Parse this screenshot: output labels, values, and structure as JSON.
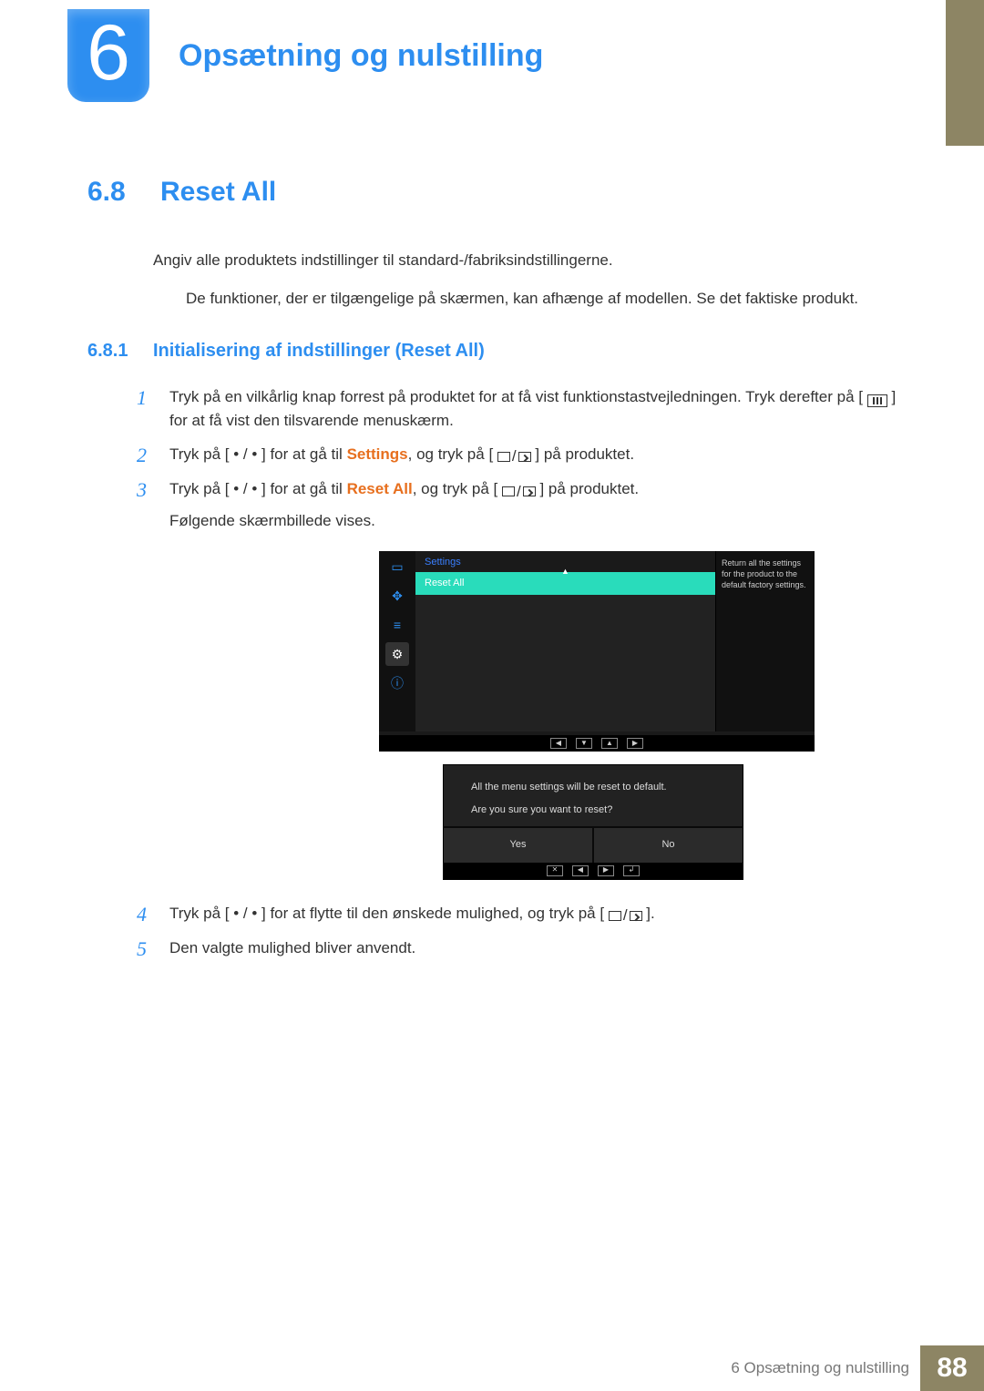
{
  "chapter": {
    "number": "6",
    "title": "Opsætning og nulstilling"
  },
  "section": {
    "number": "6.8",
    "title": "Reset All",
    "intro": "Angiv alle produktets indstillinger til standard-/fabriksindstillingerne.",
    "note": "De funktioner, der er tilgængelige på skærmen, kan afhænge af modellen. Se det faktiske produkt."
  },
  "subsection": {
    "number": "6.8.1",
    "title": "Initialisering af indstillinger (Reset All)"
  },
  "steps": {
    "s1a": "Tryk på en vilkårlig knap forrest på produktet for at få vist funktionstastvejledningen. Tryk derefter på [",
    "s1b": "] for at få vist den tilsvarende menuskærm.",
    "s2a": "Tryk på [ • / • ] for at gå til ",
    "s2hl": "Settings",
    "s2b": ", og tryk på [",
    "s2c": "] på produktet.",
    "s3a": "Tryk på [ • / • ] for at gå til ",
    "s3hl": "Reset All",
    "s3b": ", og tryk på [",
    "s3c": "] på produktet.",
    "s3d": "Følgende skærmbillede vises.",
    "s4a": "Tryk på [ • / • ] for at flytte til den ønskede mulighed, og tryk på [",
    "s4b": "].",
    "s5": "Den valgte mulighed bliver anvendt."
  },
  "osd": {
    "menu_title": "Settings",
    "menu_item": "Reset All",
    "desc": "Return all the settings for the product to the default factory settings.",
    "dialog_line1": "All the menu settings will be reset to default.",
    "dialog_line2": "Are you sure you want to reset?",
    "yes": "Yes",
    "no": "No"
  },
  "footer": {
    "text_prefix": "6 ",
    "text": "Opsætning og nulstilling",
    "page": "88"
  }
}
